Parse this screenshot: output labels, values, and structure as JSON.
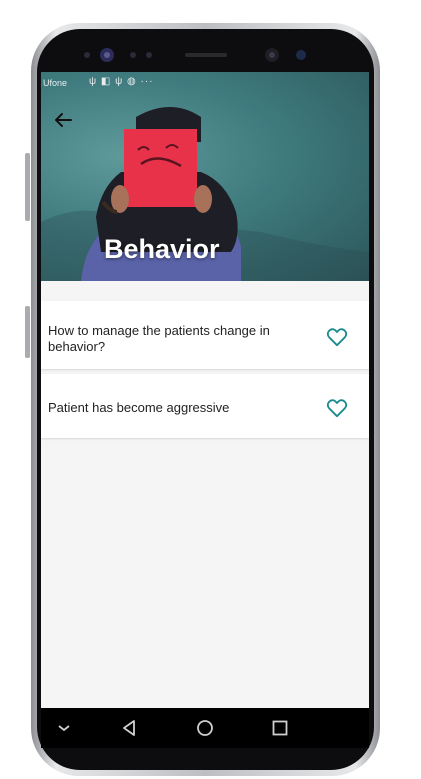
{
  "status_bar": {
    "carrier": "Ufone",
    "icons": "ψ ◧ ψ ◍ ···"
  },
  "header": {
    "title": "Behavior"
  },
  "questions": [
    {
      "text": "How to manage the patients change in behavior?"
    },
    {
      "text": "Patient has become aggressive"
    }
  ],
  "colors": {
    "accent": "#1a8a8f",
    "page_background": "#f5f5f5",
    "card_background": "#ffffff",
    "title_text": "#ffffff"
  },
  "icons": {
    "back": "arrow-left-icon",
    "favorite": "heart-outline-icon",
    "nav_back": "triangle-back-icon",
    "nav_home": "circle-home-icon",
    "nav_recent": "square-recent-icon",
    "nav_hide": "chevron-down-icon"
  }
}
